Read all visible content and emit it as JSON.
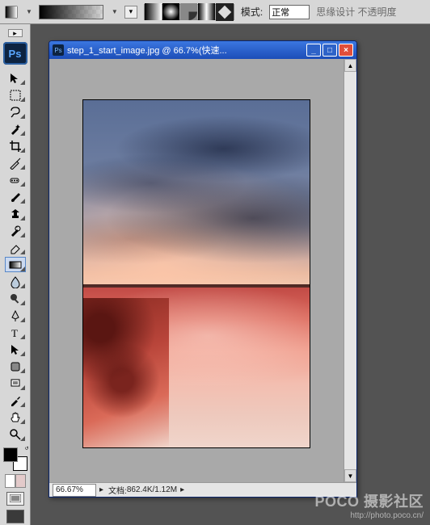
{
  "options_bar": {
    "mode_label": "模式:",
    "mode_value": "正常",
    "extra_text": "思缘设计 不透明度"
  },
  "tools": [
    {
      "name": "move-tool"
    },
    {
      "name": "marquee-tool"
    },
    {
      "name": "lasso-tool"
    },
    {
      "name": "magic-wand-tool"
    },
    {
      "name": "crop-tool"
    },
    {
      "name": "slice-tool"
    },
    {
      "name": "spot-heal-tool"
    },
    {
      "name": "brush-tool"
    },
    {
      "name": "clone-stamp-tool"
    },
    {
      "name": "history-brush-tool"
    },
    {
      "name": "eraser-tool"
    },
    {
      "name": "gradient-tool"
    },
    {
      "name": "blur-tool"
    },
    {
      "name": "dodge-tool"
    },
    {
      "name": "pen-tool"
    },
    {
      "name": "type-tool"
    },
    {
      "name": "path-select-tool"
    },
    {
      "name": "shape-tool"
    },
    {
      "name": "notes-tool"
    },
    {
      "name": "eyedropper-tool"
    },
    {
      "name": "hand-tool"
    },
    {
      "name": "zoom-tool"
    }
  ],
  "logo_text": "Ps",
  "document_window": {
    "title": "step_1_start_image.jpg @ 66.7%(快速...",
    "zoom_display": "66.67%",
    "doc_label": "文档:",
    "doc_size": "862.4K/1.12M"
  },
  "watermark": {
    "line1": "POCO 摄影社区",
    "line2": "http://photo.poco.cn/"
  }
}
